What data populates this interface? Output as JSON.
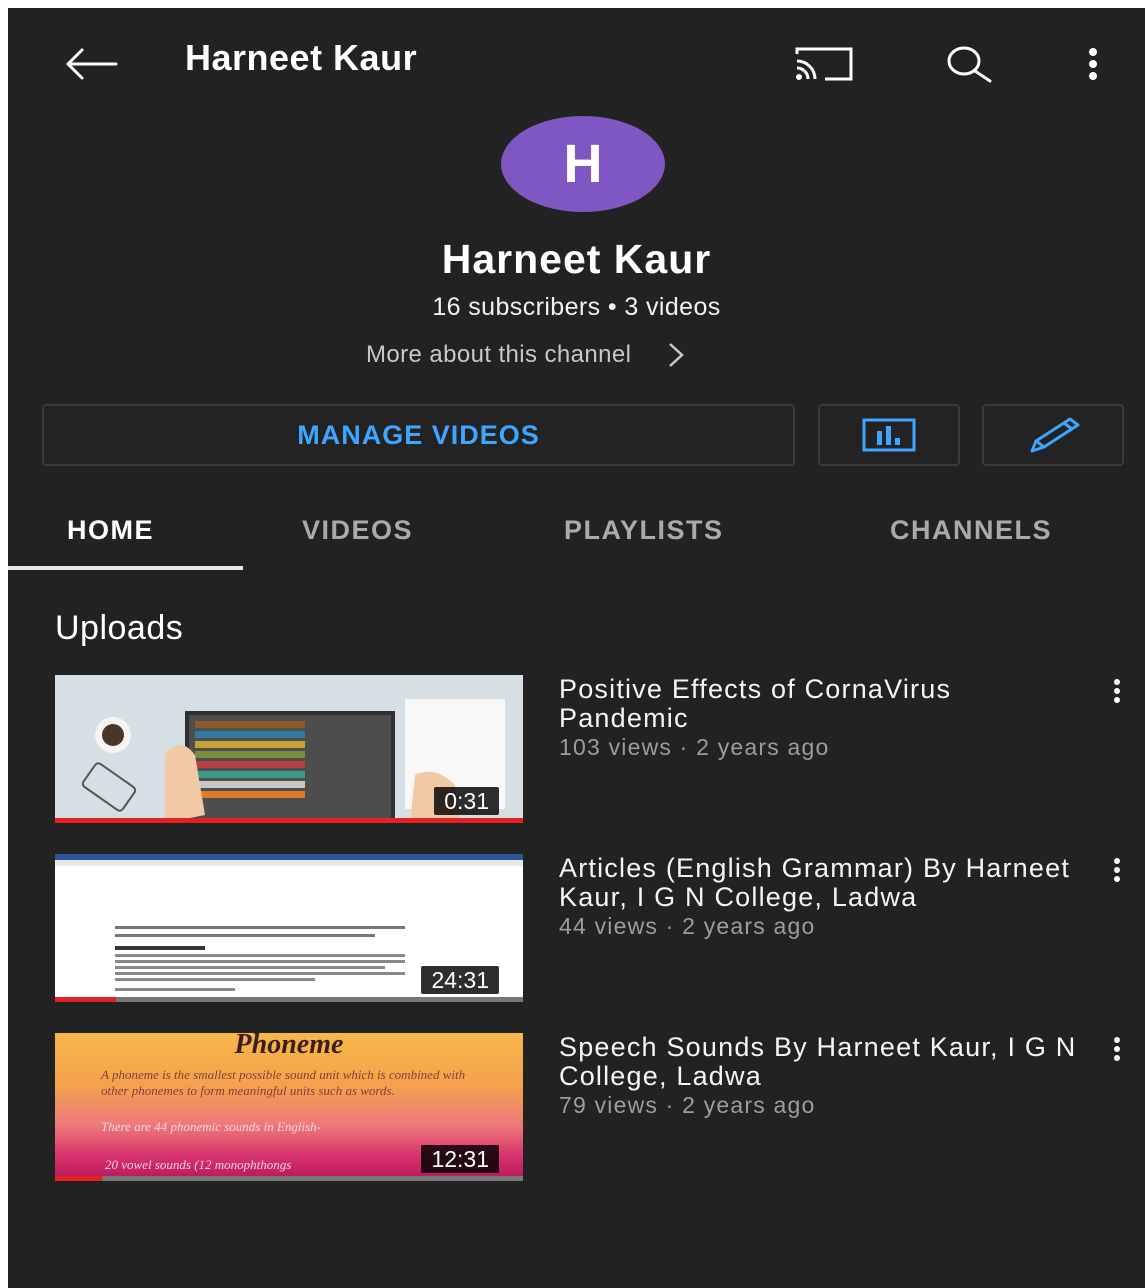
{
  "header": {
    "title": "Harneet Kaur",
    "back_icon": "back-arrow-icon",
    "cast_icon": "cast-icon",
    "search_icon": "search-icon",
    "more_icon": "more-vert-icon"
  },
  "channel": {
    "avatar_letter": "H",
    "avatar_color": "#7e57c2",
    "name": "Harneet Kaur",
    "stats": "16 subscribers • 3 videos",
    "more_about": "More about this channel"
  },
  "actions": {
    "manage_videos": "MANAGE VIDEOS",
    "accent_color": "#3ea6ff",
    "analytics_icon": "analytics-icon",
    "edit_icon": "pencil-icon"
  },
  "tabs": [
    {
      "label": "HOME",
      "selected": true
    },
    {
      "label": "VIDEOS",
      "selected": false
    },
    {
      "label": "PLAYLISTS",
      "selected": false
    },
    {
      "label": "CHANNELS",
      "selected": false
    }
  ],
  "uploads": {
    "heading": "Uploads",
    "videos": [
      {
        "title": "Positive Effects of CornaVirus Pandemic",
        "meta": "103 views · 2 years ago",
        "duration": "0:31",
        "watched_fraction": 1.0
      },
      {
        "title": "Articles (English Grammar) By Harneet Kaur, I G N College, Ladwa",
        "meta": "44 views · 2 years ago",
        "duration": "24:31",
        "watched_fraction": 0.13
      },
      {
        "title": "Speech Sounds By Harneet Kaur, I G N College, Ladwa",
        "meta": "79 views · 2 years ago",
        "duration": "12:31",
        "watched_fraction": 0.1,
        "thumbnail_text": {
          "heading": "Phoneme",
          "bullet1": "A phoneme is the smallest possible sound unit which is combined with other phonemes to form meaningful units such as words.",
          "bullet2": "There are 44 phonemic sounds in English-",
          "line3": "20 vowel sounds (12 monophthongs"
        }
      }
    ]
  }
}
